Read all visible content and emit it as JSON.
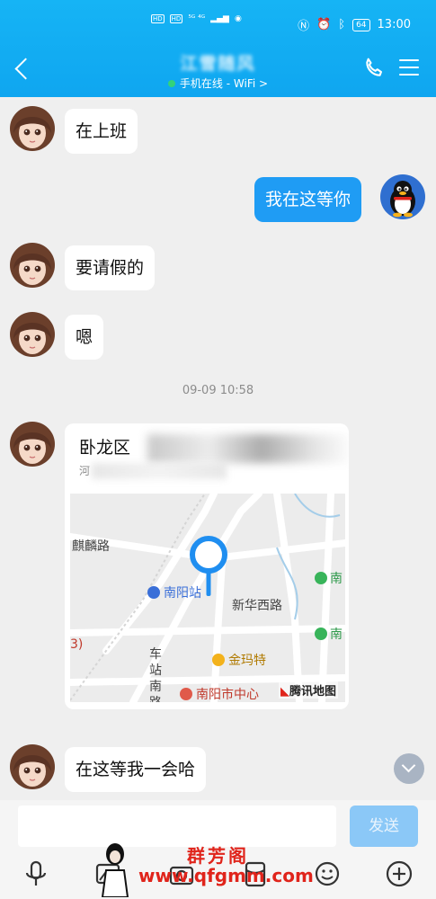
{
  "status_bar": {
    "left_tags": [
      "HD",
      "HD"
    ],
    "network": "⁵ᴳ ⁴ᴳ",
    "battery": "64",
    "time": "13:00"
  },
  "header": {
    "title": "江雪随风",
    "status_text": "手机在线 - WiFi",
    "status_chevron": ">",
    "accent": "#16b4f5"
  },
  "messages": [
    {
      "side": "left",
      "text": "在上班"
    },
    {
      "side": "right",
      "text": "我在这等你"
    },
    {
      "side": "left",
      "text": "要请假的"
    },
    {
      "side": "left",
      "text": "嗯"
    },
    {
      "side": "left",
      "text": "在这等我一会哈"
    }
  ],
  "timestamp": "09-09 10:58",
  "location_card": {
    "title": "卧龙区",
    "address": "河",
    "map_labels": {
      "road1": "麒麟路",
      "station": "南阳站",
      "road2": "新华西路",
      "road3": "车站南路",
      "poi1": "金玛特",
      "poi2": "南阳市中心",
      "right1": "南",
      "right2": "南",
      "left_edge": "3)"
    },
    "brand": "腾讯地图"
  },
  "input": {
    "placeholder": "",
    "send_label": "发送"
  },
  "watermark": {
    "title": "群芳阁",
    "url": "www.qfgmm.com"
  },
  "icons": [
    "back-icon",
    "phone-icon",
    "menu-icon",
    "microphone-icon",
    "image-icon",
    "camera-icon",
    "emoji-icon",
    "plus-icon",
    "chevron-down-icon",
    "map-pin-icon"
  ]
}
